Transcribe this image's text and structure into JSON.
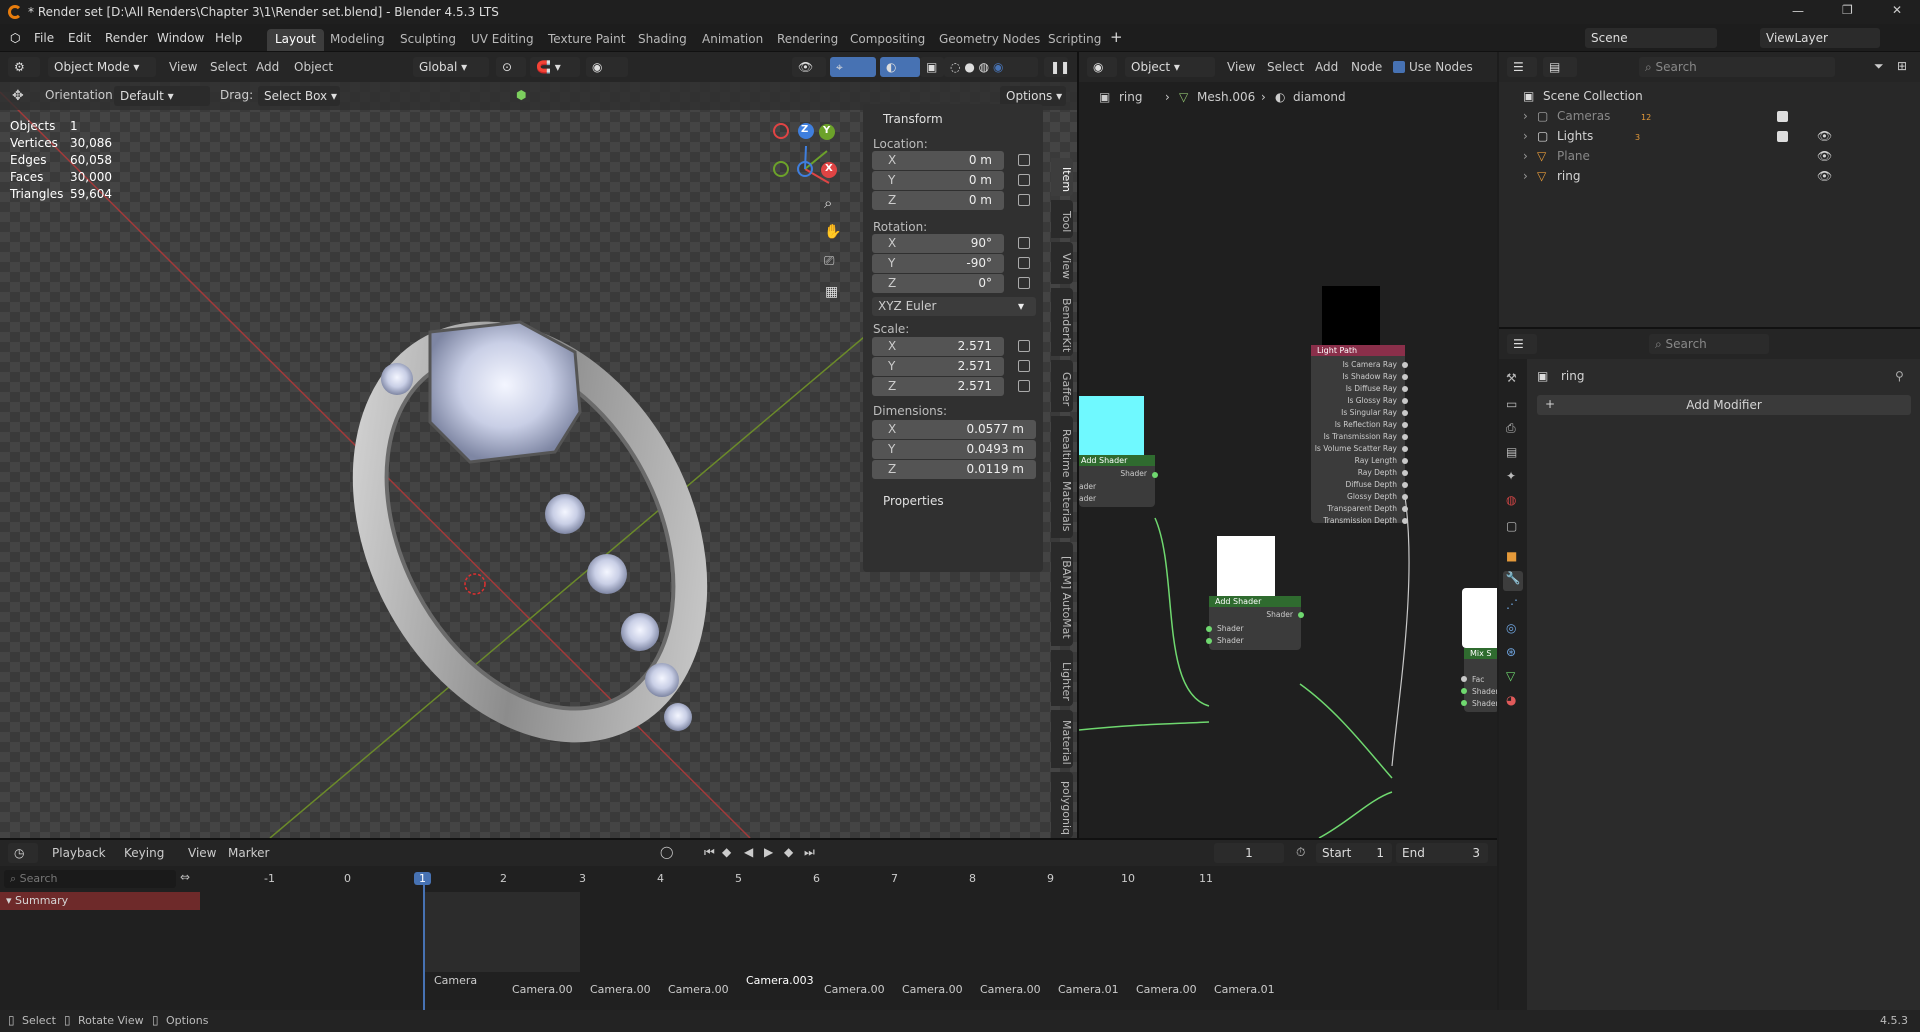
{
  "titlebar": {
    "title": "* Render set [D:\\All Renders\\Chapter 3\\1\\Render set.blend] - Blender 4.5.3 LTS"
  },
  "menu": {
    "items": [
      "File",
      "Edit",
      "Render",
      "Window",
      "Help"
    ]
  },
  "workspaces": [
    "Layout",
    "Modeling",
    "Sculpting",
    "UV Editing",
    "Texture Paint",
    "Shading",
    "Animation",
    "Rendering",
    "Compositing",
    "Geometry Nodes",
    "Scripting"
  ],
  "scene": {
    "name": "Scene",
    "view_layer": "ViewLayer"
  },
  "viewport": {
    "mode": "Object Mode",
    "menus": [
      "View",
      "Select",
      "Add",
      "Object"
    ],
    "transform_orientation": "Global",
    "orientation_label": "Orientation:",
    "orientation_value": "Default",
    "drag_label": "Drag:",
    "drag_value": "Select Box",
    "options_label": "Options",
    "stats": [
      {
        "label": "Objects",
        "value": "1"
      },
      {
        "label": "Vertices",
        "value": "30,086"
      },
      {
        "label": "Edges",
        "value": "60,058"
      },
      {
        "label": "Faces",
        "value": "30,000"
      },
      {
        "label": "Triangles",
        "value": "59,604"
      }
    ],
    "gizmo": {
      "x": "X",
      "y": "Y",
      "z": "Z"
    }
  },
  "npanel": {
    "transform_title": "Transform",
    "location_label": "Location:",
    "location": [
      {
        "axis": "X",
        "value": "0 m"
      },
      {
        "axis": "Y",
        "value": "0 m"
      },
      {
        "axis": "Z",
        "value": "0 m"
      }
    ],
    "rotation_label": "Rotation:",
    "rotation": [
      {
        "axis": "X",
        "value": "90°"
      },
      {
        "axis": "Y",
        "value": "-90°"
      },
      {
        "axis": "Z",
        "value": "0°"
      }
    ],
    "rotation_mode": "XYZ Euler",
    "scale_label": "Scale:",
    "scale": [
      {
        "axis": "X",
        "value": "2.571"
      },
      {
        "axis": "Y",
        "value": "2.571"
      },
      {
        "axis": "Z",
        "value": "2.571"
      }
    ],
    "dimensions_label": "Dimensions:",
    "dimensions": [
      {
        "axis": "X",
        "value": "0.0577 m"
      },
      {
        "axis": "Y",
        "value": "0.0493 m"
      },
      {
        "axis": "Z",
        "value": "0.0119 m"
      }
    ],
    "properties_title": "Properties",
    "tabs": [
      "Item",
      "Tool",
      "View",
      "BenderKit",
      "Gaffer",
      "Realtime Materials",
      "[BAM] AutoMat",
      "Lighter",
      "Material",
      "polygoniq"
    ]
  },
  "node_editor": {
    "object_label": "Object",
    "menus": [
      "View",
      "Select",
      "Add",
      "Node"
    ],
    "use_nodes_label": "Use Nodes",
    "breadcrumb": [
      "ring",
      "Mesh.006",
      "diamond"
    ],
    "light_path": {
      "title": "Light Path",
      "outputs": [
        "Is Camera Ray",
        "Is Shadow Ray",
        "Is Diffuse Ray",
        "Is Glossy Ray",
        "Is Singular Ray",
        "Is Reflection Ray",
        "Is Transmission Ray",
        "Is Volume Scatter Ray",
        "Ray Length",
        "Ray Depth",
        "Diffuse Depth",
        "Glossy Depth",
        "Transparent Depth",
        "Transmission Depth"
      ]
    },
    "add_shader_1": {
      "title": "Add Shader",
      "output": "Shader",
      "inputs": [
        "ader",
        "ader"
      ]
    },
    "add_shader_2": {
      "title": "Add Shader",
      "output": "Shader",
      "inputs": [
        "Shader",
        "Shader"
      ]
    },
    "mix_shader": {
      "title": "Mix S",
      "inputs": [
        "Fac",
        "Shader",
        "Shader"
      ]
    }
  },
  "outliner": {
    "search_placeholder": "Search",
    "root": "Scene Collection",
    "items": [
      {
        "name": "Cameras",
        "badge": "12"
      },
      {
        "name": "Lights",
        "badge": "3"
      },
      {
        "name": "Plane",
        "badge": ""
      },
      {
        "name": "ring",
        "badge": ""
      }
    ]
  },
  "properties": {
    "search_placeholder": "Search",
    "object_name": "ring",
    "add_modifier": "Add Modifier"
  },
  "timeline": {
    "menus": [
      "Playback",
      "Keying",
      "View",
      "Marker"
    ],
    "current_frame": "1",
    "start_label": "Start",
    "start": "1",
    "end_label": "End",
    "end": "3",
    "search_placeholder": "Search",
    "summary": "Summary",
    "ruler": [
      "-1",
      "0",
      "1",
      "2",
      "3",
      "4",
      "5",
      "6",
      "7",
      "8",
      "9",
      "10",
      "11"
    ],
    "markers": [
      "Camera",
      "Camera.00",
      "Camera.00",
      "Camera.00",
      "Camera.003",
      "Camera.00",
      "Camera.00",
      "Camera.00",
      "Camera.01",
      "Camera.00",
      "Camera.01"
    ]
  },
  "statusbar": {
    "select": "Select",
    "rotate": "Rotate View",
    "options": "Options",
    "version": "4.5.3"
  },
  "colors": {
    "accent": "#4772b3",
    "active_tab": "#3d3d3d",
    "summary": "#6e2a2a",
    "light_path_header": "#8a2f4a",
    "shader_header": "#2f6b2f"
  }
}
